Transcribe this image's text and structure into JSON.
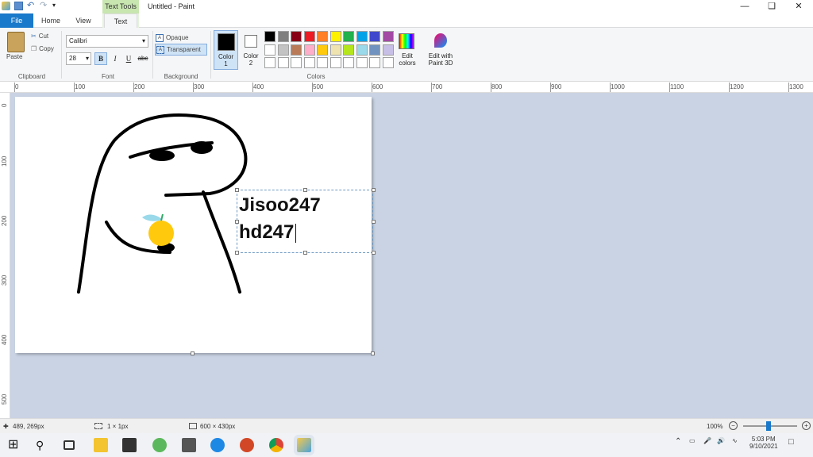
{
  "window": {
    "title": "Untitled - Paint",
    "contextual_tab": "Text Tools",
    "minimize": "—",
    "restore": "❏",
    "close": "✕"
  },
  "tabs": {
    "file": "File",
    "home": "Home",
    "view": "View",
    "text": "Text"
  },
  "ribbon": {
    "clipboard": {
      "label": "Clipboard",
      "paste": "Paste",
      "cut": "Cut",
      "copy": "Copy"
    },
    "font": {
      "label": "Font",
      "family": "Calibri",
      "size": "28",
      "bold": "B",
      "italic": "I",
      "underline": "U",
      "strike": "abc"
    },
    "background": {
      "label": "Background",
      "opaque": "Opaque",
      "transparent": "Transparent"
    },
    "colors": {
      "label": "Colors",
      "color1": "Color 1",
      "color2": "Color 2",
      "edit_colors": "Edit colors",
      "edit_paint3d": "Edit with Paint 3D",
      "color1_value": "#000000",
      "color2_value": "#ffffff",
      "palette_row1": [
        "#000000",
        "#7f7f7f",
        "#880015",
        "#ed1c24",
        "#ff7f27",
        "#fff200",
        "#22b14c",
        "#00a2e8",
        "#3f48cc",
        "#a349a4"
      ],
      "palette_row2": [
        "#ffffff",
        "#c3c3c3",
        "#b97a57",
        "#ffaec9",
        "#ffc90e",
        "#efe4b0",
        "#b5e61d",
        "#99d9ea",
        "#7092be",
        "#c8bfe7"
      ]
    }
  },
  "ruler": {
    "top": [
      "0",
      "100",
      "200",
      "300",
      "400",
      "500",
      "600",
      "700",
      "800",
      "900",
      "1000",
      "1100",
      "1200",
      "1300"
    ],
    "left": [
      "0",
      "100",
      "200",
      "300",
      "400",
      "500"
    ]
  },
  "canvas": {
    "text_line1": "Jisoo247",
    "text_line2": "hd247"
  },
  "status": {
    "cursor_pos": "489, 269px",
    "selection_size": "1 × 1px",
    "image_size": "600 × 430px",
    "zoom": "100%"
  },
  "taskbar": {
    "time": "5:03 PM",
    "date": "9/10/2021"
  }
}
